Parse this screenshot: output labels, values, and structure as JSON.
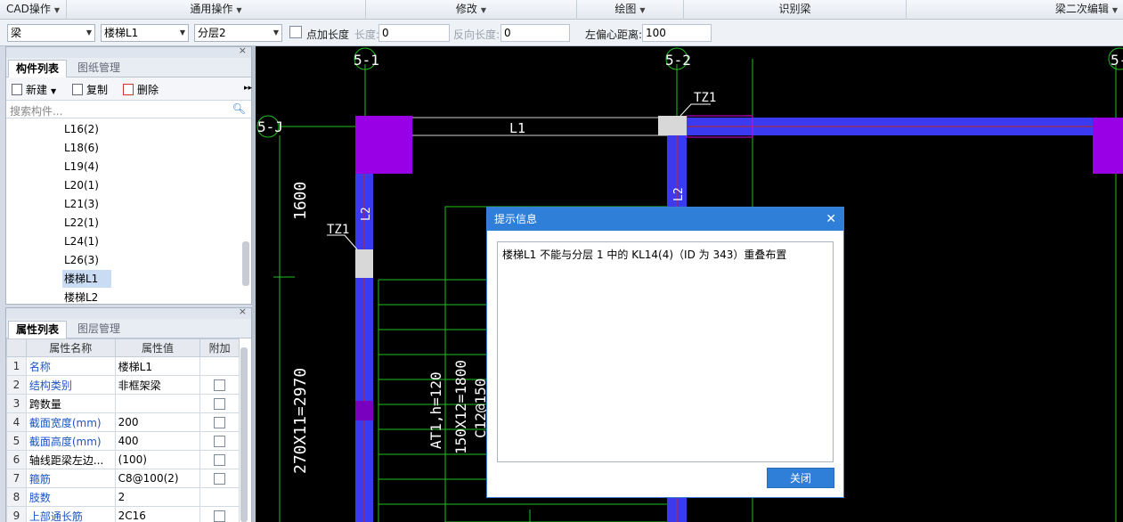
{
  "ribbon": {
    "groups": [
      {
        "label": "CAD操作",
        "has_caret": true
      },
      {
        "label": "通用操作",
        "has_caret": true
      },
      {
        "label": "修改",
        "has_caret": true
      },
      {
        "label": "绘图",
        "has_caret": true
      },
      {
        "label": "识别梁",
        "has_caret": false
      },
      {
        "label": "梁二次编辑",
        "has_caret": true
      }
    ]
  },
  "toolbar": {
    "element_type": "梁",
    "component": "楼梯L1",
    "layer": "分层2",
    "add_length_label": "点加长度",
    "length_label": "长度:",
    "length_value": "0",
    "reverse_length_label": "反向长度:",
    "reverse_length_value": "0",
    "left_offset_label": "左偏心距离:",
    "left_offset_value": "100"
  },
  "component_panel": {
    "tabs": [
      "构件列表",
      "图纸管理"
    ],
    "new_label": "新建",
    "copy_label": "复制",
    "delete_label": "删除",
    "search_placeholder": "搜索构件...",
    "items": [
      "L16(2)",
      "L18(6)",
      "L19(4)",
      "L20(1)",
      "L21(3)",
      "L22(1)",
      "L24(1)",
      "L26(3)",
      "楼梯L1",
      "楼梯L2"
    ],
    "selected_index": 8
  },
  "property_panel": {
    "tabs": [
      "属性列表",
      "图层管理"
    ],
    "headers": [
      "属性名称",
      "属性值",
      "附加"
    ],
    "rows": [
      {
        "idx": "1",
        "name": "名称",
        "value": "楼梯L1",
        "blue": true,
        "check": false
      },
      {
        "idx": "2",
        "name": "结构类别",
        "value": "非框架梁",
        "blue": true,
        "check": true
      },
      {
        "idx": "3",
        "name": "跨数量",
        "value": "",
        "blue": false,
        "check": true
      },
      {
        "idx": "4",
        "name": "截面宽度(mm)",
        "value": "200",
        "blue": true,
        "check": true
      },
      {
        "idx": "5",
        "name": "截面高度(mm)",
        "value": "400",
        "blue": true,
        "check": true
      },
      {
        "idx": "6",
        "name": "轴线距梁左边...",
        "value": "(100)",
        "blue": false,
        "check": true
      },
      {
        "idx": "7",
        "name": "箍筋",
        "value": "C8@100(2)",
        "blue": true,
        "check": true
      },
      {
        "idx": "8",
        "name": "肢数",
        "value": "2",
        "blue": true,
        "check": false
      },
      {
        "idx": "9",
        "name": "上部通长筋",
        "value": "2C16",
        "blue": true,
        "check": true
      }
    ]
  },
  "cad": {
    "axis_labels": [
      "5-1",
      "5-2",
      "5-",
      "5-J"
    ],
    "beam_labels": [
      "L1",
      "L2",
      "L2"
    ],
    "column_labels": [
      "TZ1",
      "TZ1"
    ],
    "dimensions": [
      "1600",
      "270X11=2970"
    ],
    "stair_labels": [
      "AT1,h=120",
      "150X12=1800",
      "C12@150"
    ]
  },
  "dialog": {
    "title": "提示信息",
    "message": "楼梯L1 不能与分层 1 中的 KL14(4)（ID 为 343）重叠布置",
    "close_button": "关闭"
  }
}
